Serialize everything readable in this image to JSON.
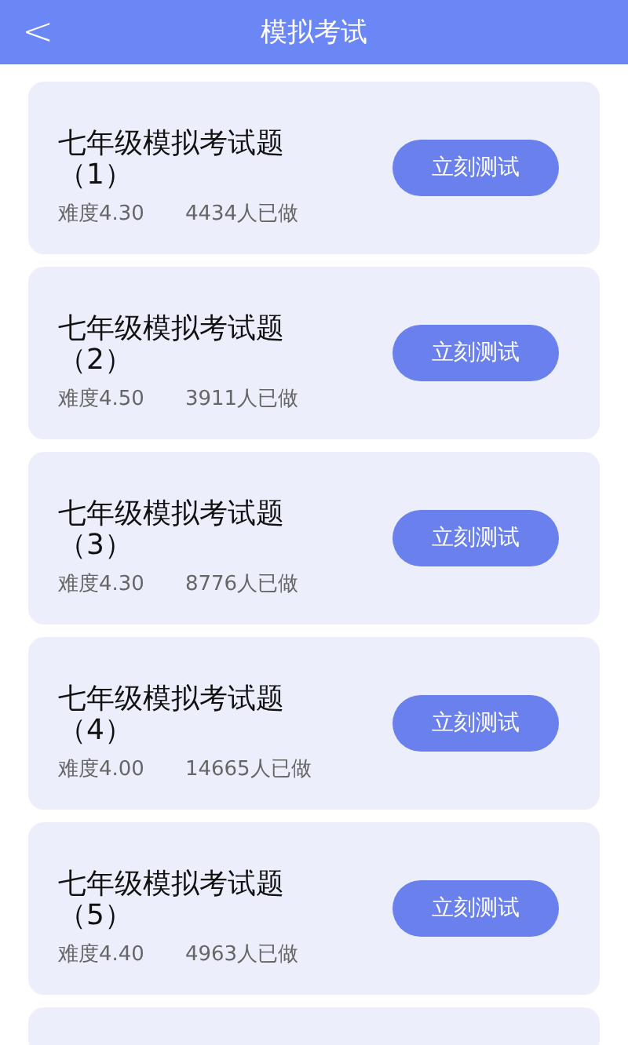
{
  "header": {
    "back": "<",
    "title": "模拟考试"
  },
  "exams": [
    {
      "kind": "exam",
      "title": "七年级模拟考试题（1）",
      "difficulty": "难度4.30",
      "count": "4434人已做",
      "button": "立刻测试"
    },
    {
      "kind": "exam",
      "title": "七年级模拟考试题（2）",
      "difficulty": "难度4.50",
      "count": "3911人已做",
      "button": "立刻测试"
    },
    {
      "kind": "exam",
      "title": "七年级模拟考试题（3）",
      "difficulty": "难度4.30",
      "count": "8776人已做",
      "button": "立刻测试"
    },
    {
      "kind": "exam",
      "title": "七年级模拟考试题（4）",
      "difficulty": "难度4.00",
      "count": "14665人已做",
      "button": "立刻测试"
    },
    {
      "kind": "exam",
      "title": "七年级模拟考试题（5）",
      "difficulty": "难度4.40",
      "count": "4963人已做",
      "button": "立刻测试"
    },
    {
      "kind": "cut"
    }
  ]
}
